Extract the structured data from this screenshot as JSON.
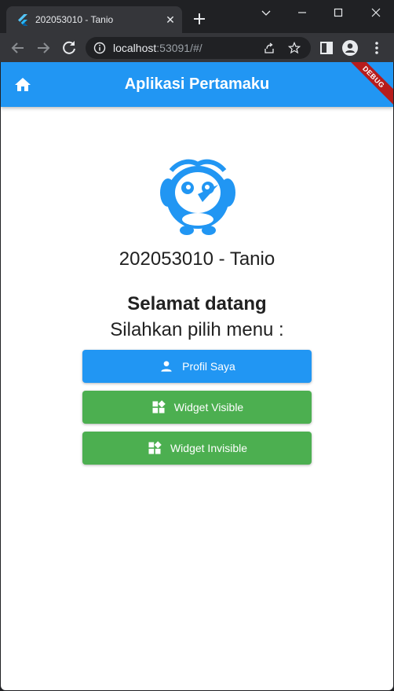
{
  "browser": {
    "tab_title": "202053010 - Tanio",
    "url_host": "localhost",
    "url_rest": ":53091/#/"
  },
  "app": {
    "title": "Aplikasi Pertamaku",
    "debug_label": "DEBUG",
    "student": "202053010 - Tanio",
    "welcome": "Selamat datang",
    "choose": "Silahkan pilih menu :",
    "buttons": {
      "profile": "Profil Saya",
      "visible": "Widget Visible",
      "invisible": "Widget Invisible"
    }
  },
  "colors": {
    "primary": "#2196f3",
    "green": "#4caf50",
    "debug": "#b71c1c"
  },
  "icons": [
    "flutter-icon",
    "close-icon",
    "plus-icon",
    "minimize-icon",
    "maximize-icon",
    "chevron-down-icon",
    "back-icon",
    "forward-icon",
    "reload-icon",
    "info-icon",
    "share-icon",
    "star-icon",
    "sidepanel-icon",
    "profile-icon",
    "more-icon",
    "home-icon",
    "bird-logo-icon",
    "person-icon",
    "widgets-icon"
  ]
}
